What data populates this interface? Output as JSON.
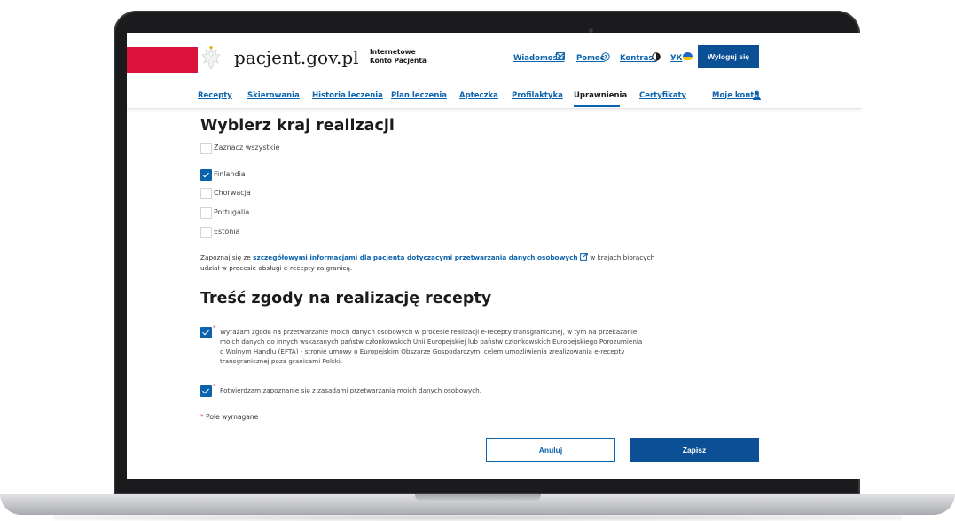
{
  "header": {
    "site_name": "pacjent.gov.pl",
    "site_sub_line1": "Internetowe",
    "site_sub_line2": "Konto Pacjenta",
    "links": {
      "news": "Wiadomości",
      "help": "Pomoc",
      "contrast": "Kontrast",
      "language": "УК"
    },
    "logout_label": "Wyloguj się"
  },
  "nav": {
    "items": [
      "Recepty",
      "Skierowania",
      "Historia leczenia",
      "Plan leczenia",
      "Apteczka",
      "Profilaktyka",
      "Uprawnienia",
      "Certyfikaty",
      "Moje konto"
    ],
    "active": "Uprawnienia"
  },
  "country_section": {
    "title": "Wybierz kraj realizacji",
    "select_all_label": "Zaznacz wszystkie",
    "select_all_checked": false,
    "countries": [
      {
        "label": "Finlandia",
        "checked": true
      },
      {
        "label": "Chorwacja",
        "checked": false
      },
      {
        "label": "Portugalia",
        "checked": false
      },
      {
        "label": "Estonia",
        "checked": false
      }
    ],
    "info_prefix": "Zapoznaj się ze ",
    "info_link": "szczegółowymi informacjami dla pacjenta dotyczącymi przetwarzania danych osobowych",
    "info_suffix": " w krajach biorących udział w procesie obsługi e-recepty za granicą."
  },
  "consent_section": {
    "title": "Treść zgody na realizację recepty",
    "consents": [
      {
        "text": "Wyrażam zgodę na przetwarzanie moich danych osobowych w procesie realizacji e-recepty transgranicznej, w tym na przekazanie moich danych do innych wskazanych państw członkowskich Unii Europejskiej lub państw członkowskich Europejskiego Porozumienia o Wolnym Handlu (EFTA) - stronie umowy o Europejskim Obszarze Gospodarczym, celem umożliwienia zrealizowania e-recepty transgranicznej poza granicami Polski.",
        "checked": true,
        "required": true
      },
      {
        "text": "Potwierdzam zapoznanie się z zasadami przetwarzania moich danych osobowych.",
        "checked": true,
        "required": true
      }
    ],
    "required_star": "*",
    "required_note": "Pole wymagane"
  },
  "actions": {
    "cancel_label": "Anuluj",
    "save_label": "Zapisz"
  },
  "colors": {
    "brand_blue": "#0b63ad",
    "dark_blue": "#0b4f94",
    "red": "#dc143c"
  }
}
